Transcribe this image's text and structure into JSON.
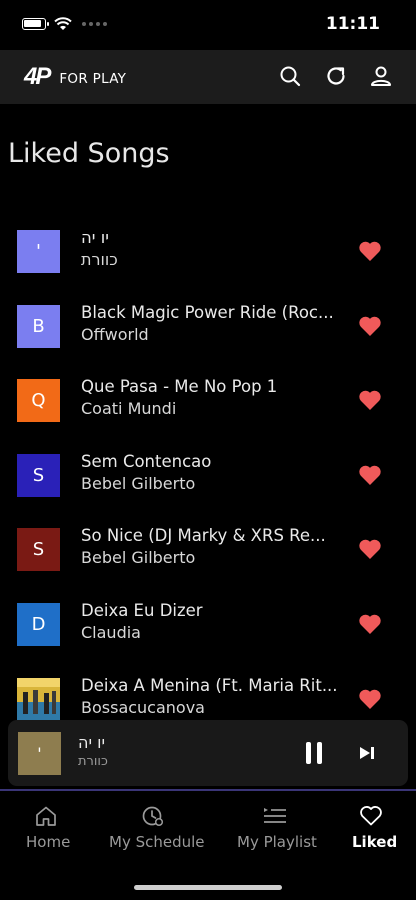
{
  "status_bar": {
    "time": "11:11"
  },
  "header": {
    "logo_mark": "4P",
    "logo_text": "FOR PLAY",
    "icons": [
      "search-icon",
      "refresh-icon",
      "profile-icon"
    ]
  },
  "page": {
    "title": "Liked Songs"
  },
  "songs": [
    {
      "title": "יו יה",
      "artist": "כוורת",
      "thumb_letter": "'",
      "thumb_color": "#7b7ef0"
    },
    {
      "title": "Black Magic Power Ride (Roc...",
      "artist": "Offworld",
      "thumb_letter": "B",
      "thumb_color": "#7b7ef0"
    },
    {
      "title": "Que Pasa - Me No Pop 1",
      "artist": "Coati Mundi",
      "thumb_letter": "Q",
      "thumb_color": "#f26a17"
    },
    {
      "title": "Sem Contencao",
      "artist": "Bebel Gilberto",
      "thumb_letter": "S",
      "thumb_color": "#2a21b8"
    },
    {
      "title": "So Nice (DJ Marky & XRS Re...",
      "artist": "Bebel Gilberto",
      "thumb_letter": "S",
      "thumb_color": "#7a1a14"
    },
    {
      "title": "Deixa Eu Dizer",
      "artist": "Claudia",
      "thumb_letter": "D",
      "thumb_color": "#1f6fc8"
    },
    {
      "title": "Deixa A Menina (Ft. Maria Rit...",
      "artist": "Bossacucanova",
      "thumb_letter": "",
      "thumb_color": "#d9b53a"
    }
  ],
  "colors": {
    "heart": "#f05a5a",
    "accent": "#3a3577"
  },
  "mini_player": {
    "title": "יו יה",
    "artist": "כוורת",
    "thumb_letter": "'"
  },
  "nav": {
    "items": [
      {
        "label": "Home",
        "icon": "home-icon"
      },
      {
        "label": "My Schedule",
        "icon": "schedule-icon"
      },
      {
        "label": "My Playlist",
        "icon": "playlist-icon"
      },
      {
        "label": "Liked",
        "icon": "heart-outline-icon",
        "active": true
      }
    ]
  }
}
